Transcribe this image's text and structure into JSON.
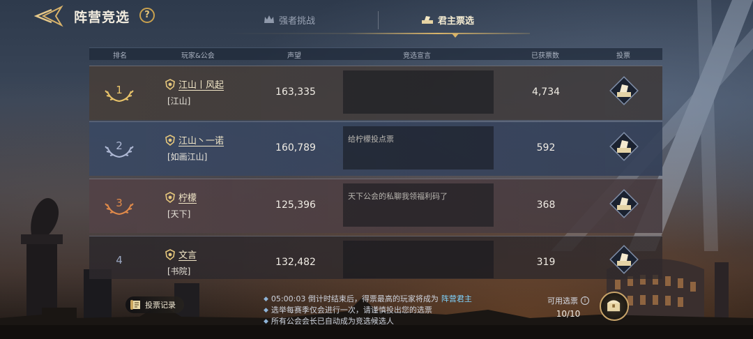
{
  "header": {
    "title": "阵营竞选",
    "help_label": "?"
  },
  "tabs": [
    {
      "label": "强者挑战",
      "active": false
    },
    {
      "label": "君主票选",
      "active": true
    }
  ],
  "table": {
    "columns": [
      "排名",
      "玩家&公会",
      "声望",
      "竞选宣言",
      "已获票数",
      "投票"
    ],
    "rows": [
      {
        "rank": "1",
        "name": "江山丨风起",
        "guild": "[江山]",
        "prestige": "163,335",
        "slogan": "",
        "votes": "4,734"
      },
      {
        "rank": "2",
        "name": "江山丶一诺",
        "guild": "[如画江山]",
        "prestige": "160,789",
        "slogan": "给柠檬投点票",
        "votes": "592"
      },
      {
        "rank": "3",
        "name": "柠檬",
        "guild": "[天下]",
        "prestige": "125,396",
        "slogan": "天下公会的私聊我领福利码了",
        "votes": "368"
      },
      {
        "rank": "4",
        "name": "文言",
        "guild": "[书院]",
        "prestige": "132,482",
        "slogan": "",
        "votes": "319"
      }
    ]
  },
  "bottom": {
    "vote_record_label": "投票记录",
    "note1_prefix": "05:00:03 倒计时结束后，得票最高的玩家将成为",
    "note1_highlight": "阵营君主",
    "note2": "选举每赛季仅会进行一次，请谨慎投出您的选票",
    "note3": "所有公会会长已自动成为竞选候选人",
    "available_label": "可用选票",
    "available_count": "10/10"
  },
  "colors": {
    "gold": "#d8b46a",
    "highlight": "#7fd4ff",
    "rank1": "#e9c46a",
    "rank2": "#aeb8d4",
    "rank3": "#e08a4a"
  },
  "icons": [
    "back-arrow-icon",
    "help-icon",
    "crown-icon",
    "ballot-icon",
    "guild-badge-icon",
    "laurel-icon",
    "vote-icon",
    "scroll-icon",
    "info-icon",
    "chest-icon"
  ]
}
